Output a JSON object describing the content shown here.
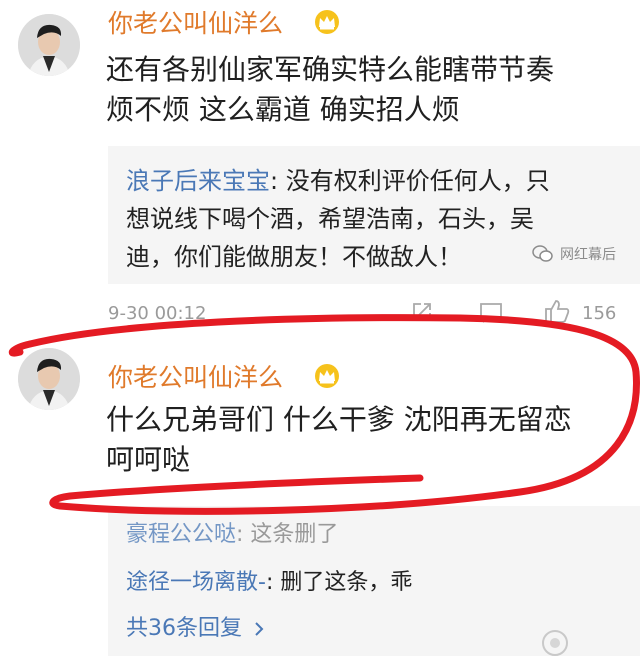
{
  "comment1": {
    "username": "你老公叫仙洋么",
    "badge_icon": "crown-icon",
    "content_line1": "还有各别仙家军确实特么能瞎带节奏",
    "content_line2": "烦不烦 这么霸道 确实招人烦",
    "reply": {
      "author": "浪子后来宝宝",
      "line1_text": ": 没有权利评价任何人，只",
      "line2": "想说线下喝个酒，希望浩南，石头，吴",
      "line3": "迪，你们能做朋友！不做敌人！"
    },
    "timestamp": "9-30 00:12",
    "like_count": "156"
  },
  "watermark": {
    "text": "网红幕后",
    "icon": "wechat-icon"
  },
  "comment2": {
    "username": "你老公叫仙洋么",
    "badge_icon": "crown-icon",
    "content_line1": "什么兄弟哥们 什么干爹 沈阳再无留恋",
    "content_line2": "呵呵哒",
    "replies": [
      {
        "author": "豪程公公哒",
        "text": ": 这条删了"
      },
      {
        "author": "途径一场离散-",
        "text": ": 删了这条，乖"
      }
    ],
    "more_replies": "共36条回复",
    "more_icon": "chevron-right-icon"
  },
  "colors": {
    "username": "#e07a2b",
    "link": "#4a78b6",
    "annotation_red": "#e41b23"
  }
}
